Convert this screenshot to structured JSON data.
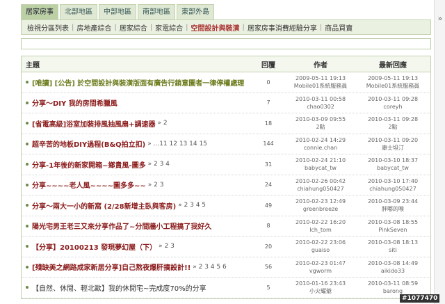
{
  "tabs": [
    "居家房事",
    "北部地區",
    "中部地區",
    "南部地區",
    "東部外島"
  ],
  "scroll_glyph": "»",
  "subnav": {
    "items": [
      "檢視分區列表",
      "房地產綜合",
      "居家綜合",
      "家電綜合",
      "空間設計與裝潢",
      "居家房事消費經驗分享",
      "商品買賣"
    ],
    "active_index": 4,
    "separator": "|"
  },
  "table": {
    "headers": {
      "title": "主題",
      "replies": "回覆",
      "author": "作者",
      "last": "最新回應"
    },
    "rows": [
      {
        "title": "[唯讀] [公告] 於空間設計與裝潢版面有廣告行銷意圖者一律停權處理",
        "style": "green",
        "pages": "",
        "replies": "0",
        "author_date": "2009-05-11 19:13",
        "author": "Mobile01系統服務員",
        "last_date": "2009-05-11 19:13",
        "last_user": "Mobile01系統服務員"
      },
      {
        "title": "分享～DIY 我的房間希臘風",
        "style": "red",
        "pages": "",
        "replies": "7",
        "author_date": "2010-03-11 00:58",
        "author": "chao0302",
        "last_date": "2010-03-11 09:28",
        "last_user": "coreyh"
      },
      {
        "title": "[省電高級]浴室加裝排風抽風扇+調速器",
        "style": "red",
        "pages": "» 2",
        "replies": "18",
        "author_date": "2010-03-09 09:55",
        "author": "2點",
        "last_date": "2010-03-11 09:28",
        "last_user": "2點"
      },
      {
        "title": "超辛苦的地板DIY過程(B&Q拍立扣)",
        "style": "red",
        "pages": "» ...11 12 13 14 15",
        "replies": "144",
        "author_date": "2010-02-24 14:29",
        "author": "connie.chan",
        "last_date": "2010-03-11 09:20",
        "last_user": "康士坦汀"
      },
      {
        "title": "分享-1年後的新家開箱~鄉貴風-圖多",
        "style": "red",
        "pages": "» 2 3 4",
        "replies": "31",
        "author_date": "2010-02-24 21:10",
        "author": "babycat_tw",
        "last_date": "2010-03-10 18:37",
        "last_user": "babycat_tw"
      },
      {
        "title": "分享~~~~老人風~~~~圖多多~~",
        "style": "red",
        "pages": "» 2 3",
        "replies": "24",
        "author_date": "2010-02-26 00:42",
        "author": "chiahung050427",
        "last_date": "2010-03-10 17:40",
        "last_user": "chiahung050427"
      },
      {
        "title": "分享～兩大一小的新窩 (2/28新增主臥與客房)",
        "style": "red",
        "pages": "» 2 3 4 5",
        "replies": "49",
        "author_date": "2010-02-23 12:49",
        "author": "greenbreeze",
        "last_date": "2010-03-09 23:44",
        "last_user": "胖嘟的喉"
      },
      {
        "title": "陽光宅男王老三又來分享作品了~分間牆小工程搞了我好久",
        "style": "red",
        "pages": "",
        "replies": "8",
        "author_date": "2010-02-22 16:20",
        "author": "lch_tom",
        "last_date": "2010-03-08 18:55",
        "last_user": "PinkSeven"
      },
      {
        "title": "【分享】20100213 發現夢幻屋（下）",
        "style": "red",
        "pages": "» 2 3",
        "replies": "20",
        "author_date": "2010-02-22 23:06",
        "author": "guaiso",
        "last_date": "2010-03-08 18:13",
        "last_user": "siti"
      },
      {
        "title": "[殘缺美之網路成家新居分享]自己熬夜爆肝搞設計!!",
        "style": "red",
        "pages": "» 2 3 4 5 6",
        "replies": "56",
        "author_date": "2010-02-23 01:47",
        "author": "vgworm",
        "last_date": "2010-03-08 14:49",
        "last_user": "aikido33"
      },
      {
        "title": "【自然、休閒、輕北歐】我的休閒宅~完成度70%的分享",
        "style": "plain",
        "pages": "",
        "replies": "5",
        "author_date": "2010-01-16 23:43",
        "author": "小火耀爺",
        "last_date": "2010-03-11 08:59",
        "last_user": "barong"
      }
    ]
  },
  "watermark": "#1077470"
}
